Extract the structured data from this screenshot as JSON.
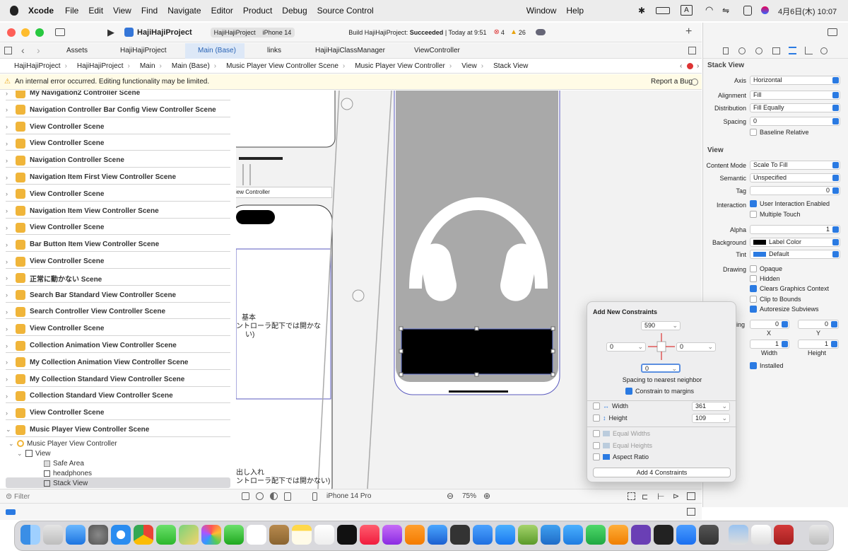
{
  "menubar": {
    "apple": "",
    "items": [
      "Xcode",
      "File",
      "Edit",
      "View",
      "Find",
      "Navigate",
      "Editor",
      "Product",
      "Debug",
      "Source Control",
      "Window",
      "Help"
    ],
    "input": "A",
    "clock": "4月6日(木) 10:07"
  },
  "toolbar": {
    "project": "HajiHajiProject",
    "target": "HajiHajiProject",
    "device": "iPhone 14",
    "build_prefix": "Build HajiHajiProject: ",
    "build_status": "Succeeded",
    "build_time": "| Today at 9:51",
    "errors": "4",
    "warnings": "26"
  },
  "tabs": [
    "Assets",
    "HajiHajiProject",
    "Main (Base)",
    "links",
    "HajiHajiClassManager",
    "ViewController"
  ],
  "jumpbar": [
    "HajiHajiProject",
    "HajiHajiProject",
    "Main",
    "Main (Base)",
    "Music Player View Controller Scene",
    "Music Player View Controller",
    "View",
    "Stack View"
  ],
  "warning": {
    "text": "An internal error occurred. Editing functionality may be limited.",
    "report": "Report a Bug"
  },
  "outline": {
    "scenes": [
      "My Navigation2 Controller Scene",
      "Navigation Controller Bar Config View Controller Scene",
      "View Controller Scene",
      "View Controller Scene",
      "Navigation Controller Scene",
      "Navigation Item First View Controller Scene",
      "View Controller Scene",
      "Navigation Item View Controller Scene",
      "View Controller Scene",
      "Bar Button Item View Controller Scene",
      "View Controller Scene",
      "正常に動かない Scene",
      "Search Bar Standard View Controller Scene",
      "Search Controller View Controller Scene",
      "View Controller Scene",
      "Collection Animation View Controller Scene",
      "My Collection Animation View Controller Scene",
      "My Collection Standard View Controller Scene",
      "Collection Standard View Controller Scene",
      "View Controller Scene",
      "Music Player View Controller Scene"
    ],
    "tree": [
      "Music Player View Controller",
      "View",
      "Safe Area",
      "headphones",
      "Stack View"
    ],
    "filter_placeholder": "Filter"
  },
  "canvas": {
    "vc_label": "iew Controller",
    "text1": "基本",
    "text2": "ントローラ配下では開かな",
    "text3": "い)",
    "text4": "出し入れ",
    "text5": "ントローラ配下では開かない)"
  },
  "bottombar": {
    "device": "iPhone 14 Pro",
    "zoom": "75%"
  },
  "popover": {
    "title": "Add New Constraints",
    "top": "590",
    "left": "0",
    "right": "0",
    "bottom": "0",
    "spacing": "Spacing to nearest neighbor",
    "margins": "Constrain to margins",
    "width_label": "Width",
    "width_value": "361",
    "height_label": "Height",
    "height_value": "109",
    "equal_widths": "Equal Widths",
    "equal_heights": "Equal Heights",
    "aspect": "Aspect Ratio",
    "add_button": "Add 4 Constraints"
  },
  "inspector": {
    "stack_title": "Stack View",
    "axis_label": "Axis",
    "axis": "Horizontal",
    "alignment_label": "Alignment",
    "alignment": "Fill",
    "distribution_label": "Distribution",
    "distribution": "Fill Equally",
    "spacing_label": "Spacing",
    "spacing": "0",
    "baseline": "Baseline Relative",
    "view_title": "View",
    "content_mode_label": "Content Mode",
    "content_mode": "Scale To Fill",
    "semantic_label": "Semantic",
    "semantic": "Unspecified",
    "tag_label": "Tag",
    "tag": "0",
    "interaction_label": "Interaction",
    "user_interaction": "User Interaction Enabled",
    "multiple_touch": "Multiple Touch",
    "alpha_label": "Alpha",
    "alpha": "1",
    "background_label": "Background",
    "background": "Label Color",
    "tint_label": "Tint",
    "tint": "Default",
    "drawing_label": "Drawing",
    "opaque": "Opaque",
    "hidden": "Hidden",
    "clears": "Clears Graphics Context",
    "clip": "Clip to Bounds",
    "autoresize": "Autoresize Subviews",
    "stretching_label": "ching",
    "x_value": "0",
    "y_value": "0",
    "x_label": "X",
    "y_label": "Y",
    "w_value": "1",
    "h_value": "1",
    "width_label": "Width",
    "height_label": "Height",
    "installed": "Installed"
  },
  "colors": {
    "accent": "#2a7ae2",
    "selection": "#dde8f7",
    "scene_icon": "#f0b53a",
    "canvas_bg": "#f2f2f2",
    "device_fill": "#a9a9a9"
  }
}
